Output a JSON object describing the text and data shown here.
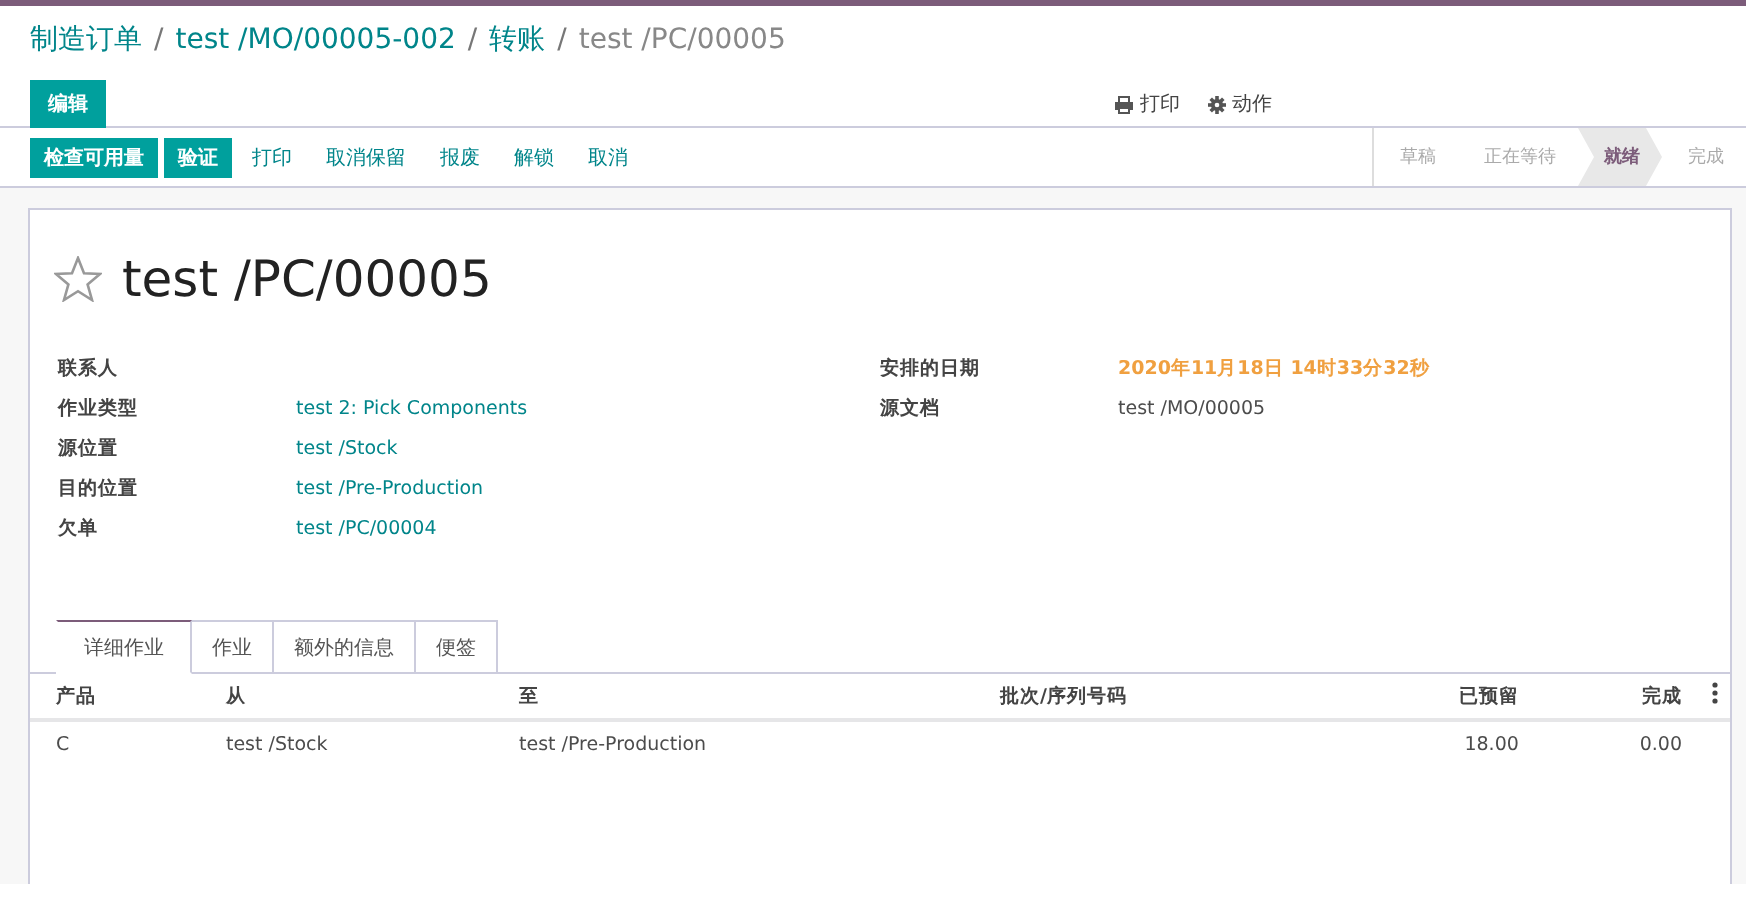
{
  "breadcrumb": [
    {
      "label": "制造订单",
      "kind": "link"
    },
    {
      "separator": "/",
      "label": "test /MO/00005-002",
      "kind": "link"
    },
    {
      "separator": "/",
      "label": "转账",
      "kind": "link"
    },
    {
      "separator": "/",
      "label": "test /PC/00005",
      "kind": "current"
    }
  ],
  "edit_button": "编辑",
  "header_actions": [
    {
      "label": "打印"
    },
    {
      "label": "动作"
    }
  ],
  "actions": [
    {
      "label": "检查可用量",
      "kind": "primary"
    },
    {
      "label": "验证",
      "kind": "primary"
    },
    {
      "label": "打印",
      "kind": "link"
    },
    {
      "label": "取消保留",
      "kind": "link"
    },
    {
      "label": "报废",
      "kind": "link"
    },
    {
      "label": "解锁",
      "kind": "link"
    },
    {
      "label": "取消",
      "kind": "link"
    }
  ],
  "stages": [
    {
      "label": "草稿",
      "selected": false
    },
    {
      "label": "正在等待",
      "selected": false
    },
    {
      "label": "就绪",
      "selected": true
    },
    {
      "label": "完成",
      "selected": false
    }
  ],
  "record": {
    "title": "test /PC/00005",
    "starred": false
  },
  "left_fields": [
    {
      "label": "联系人"
    },
    {
      "label": "作业类型",
      "value": "test 2: Pick Components",
      "kind": "link"
    },
    {
      "label": "源位置",
      "value": "test /Stock",
      "kind": "link"
    },
    {
      "label": "目的位置",
      "value": "test /Pre-Production",
      "kind": "link"
    },
    {
      "label": "欠单",
      "value": "test /PC/00004",
      "kind": "link"
    }
  ],
  "right_fields": [
    {
      "label": "安排的日期",
      "value": "2020年11月18日 14时33分32秒",
      "kind": "date"
    },
    {
      "label": "源文档",
      "value": "test /MO/00005",
      "kind": "plain"
    }
  ],
  "tabs": [
    {
      "label": "详细作业",
      "selected": true
    },
    {
      "label": "作业",
      "selected": false
    },
    {
      "label": "额外的信息",
      "selected": false
    },
    {
      "label": "便签",
      "selected": false
    }
  ],
  "table": {
    "columns": [
      "产品",
      "从",
      "至",
      "批次/序列号码",
      "已预留",
      "完成"
    ],
    "rows": [
      [
        "C",
        "test /Stock",
        "test /Pre-Production",
        "",
        "18.00",
        "0.00"
      ]
    ]
  }
}
